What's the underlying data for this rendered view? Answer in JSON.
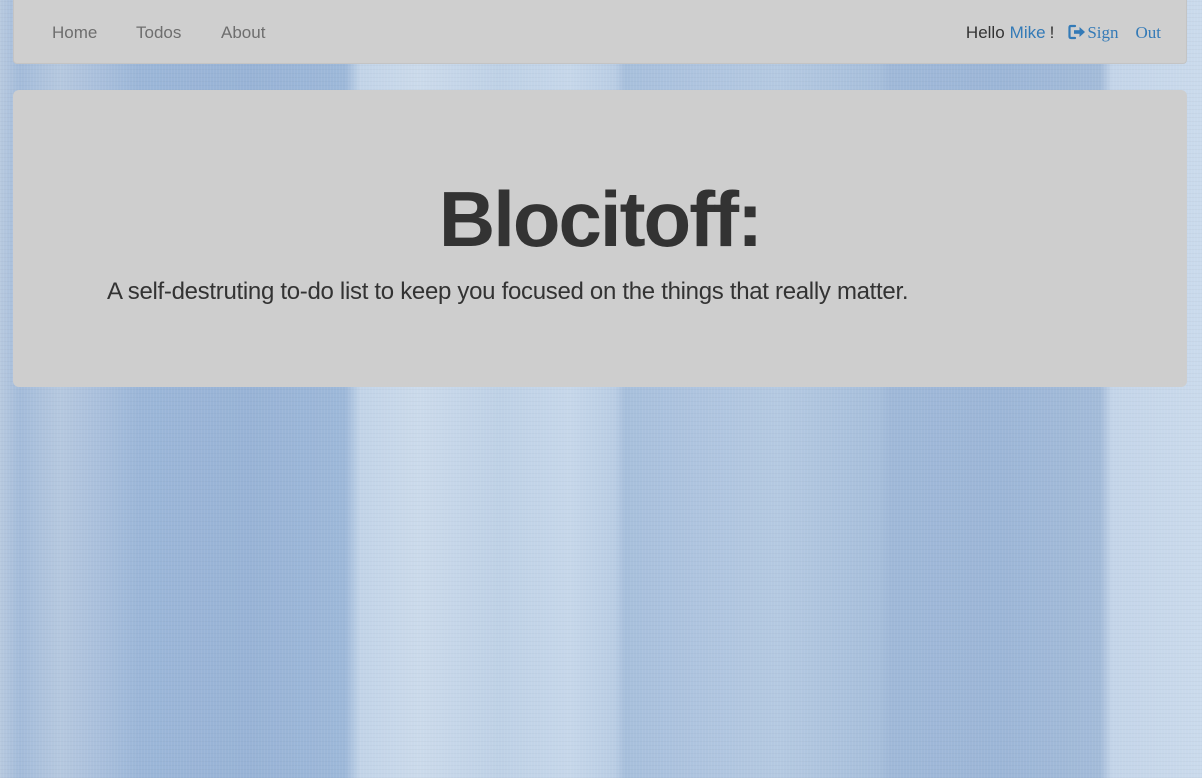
{
  "navbar": {
    "links": [
      {
        "label": "Home"
      },
      {
        "label": "Todos"
      },
      {
        "label": "About"
      }
    ],
    "greeting": "Hello",
    "user_name": "Mike",
    "exclamation": "!",
    "signout_word1": "Sign",
    "signout_word2": "Out",
    "signout_icon": "sign-out-icon"
  },
  "hero": {
    "title": "Blocitoff:",
    "lead": "A self-destruting to-do list to keep you focused on the things that really matter."
  },
  "colors": {
    "link": "#337ab7",
    "text": "#333333",
    "panel": "#cecece"
  }
}
